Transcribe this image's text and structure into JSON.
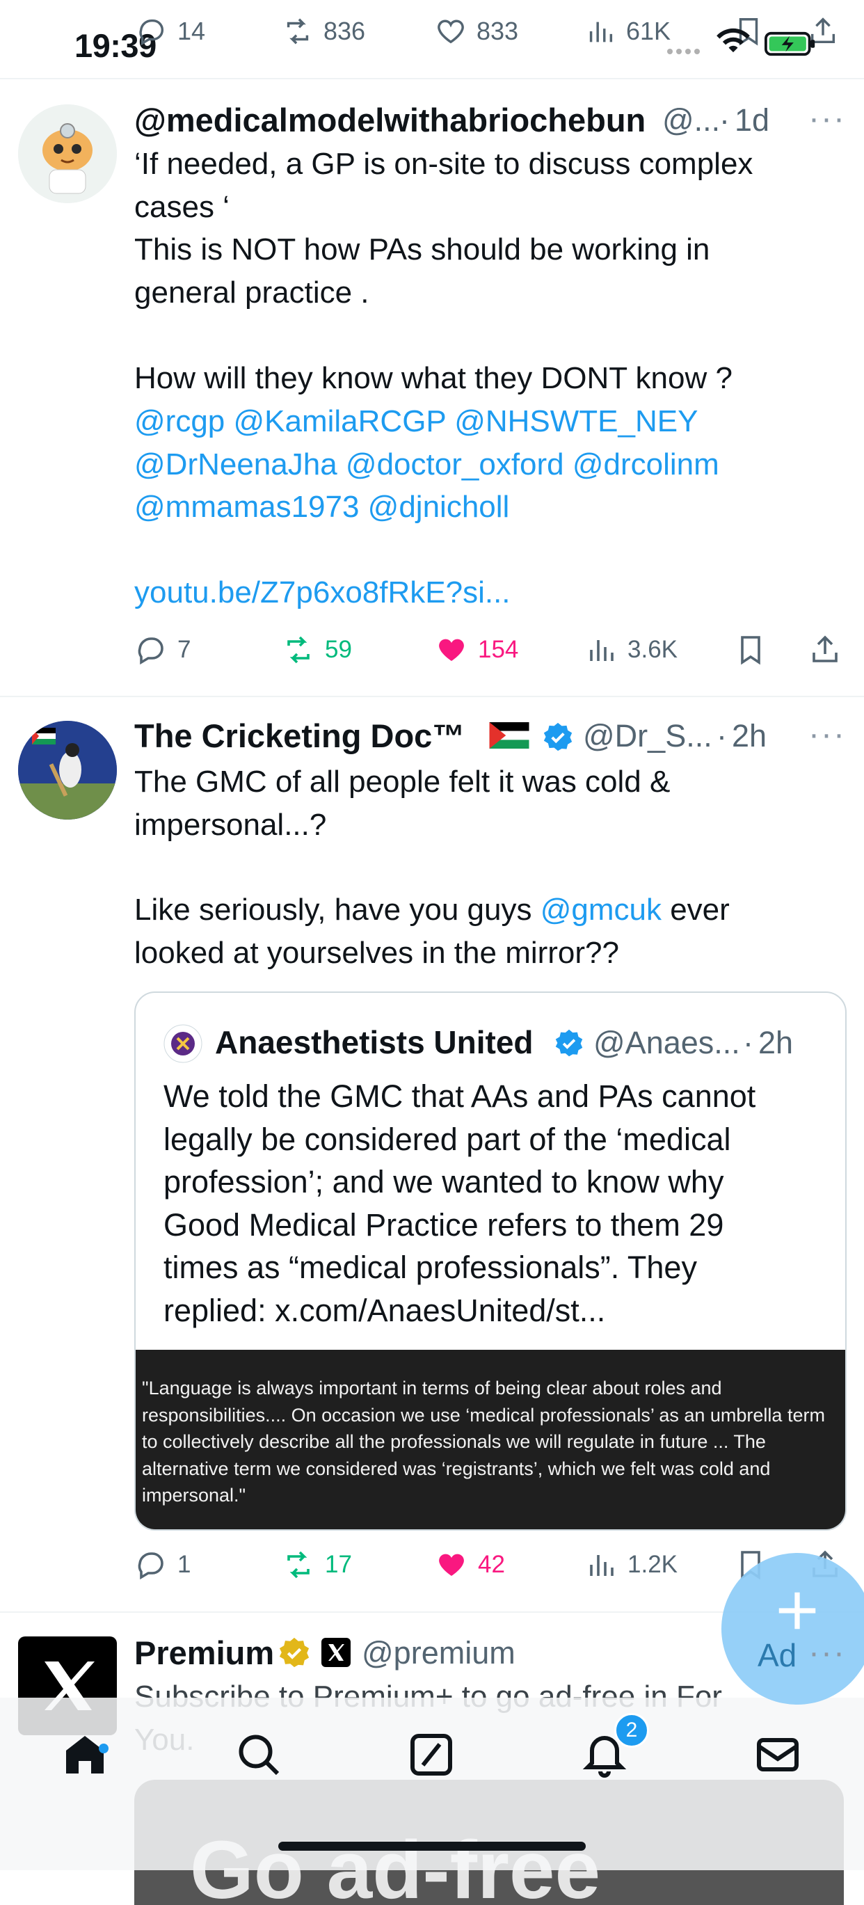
{
  "status_bar": {
    "time": "19:39"
  },
  "prev_tweet_actions": {
    "replies": "14",
    "reposts": "836",
    "likes": "833",
    "views": "61K"
  },
  "tweet1": {
    "name": "@medicalmodelwithabriochebun",
    "handle": "@...",
    "dot": "·",
    "time": "1d",
    "more": "···",
    "line1": "‘If needed, a GP is on-site  to discuss complex\ncases ‘\nThis is NOT how PAs should be working in\ngeneral practice .",
    "line2": "How will they know what they DONT know ?",
    "mentions": "@rcgp @KamilaRCGP @NHSWTE_NEY\n@DrNeenaJha @doctor_oxford @drcolinm\n@mmamas1973 @djnicholl",
    "link": "youtu.be/Z7p6xo8fRkE?si...",
    "replies": "7",
    "reposts": "59",
    "likes": "154",
    "views": "3.6K"
  },
  "tweet2": {
    "name": "The Cricketing Doc™",
    "handle": "@Dr_S...",
    "dot": "·",
    "time": "2h",
    "more": "···",
    "line1": "The GMC of all people felt it was cold &\nimpersonal...?",
    "line2a": "Like seriously, have you guys ",
    "mention": "@gmcuk",
    "line2b": " ever",
    "line2c": "looked at yourselves in the mirror??",
    "replies": "1",
    "reposts": "17",
    "likes": "42",
    "views": "1.2K"
  },
  "quote": {
    "name": "Anaesthetists United",
    "handle": "@Anaes...",
    "dot": "·",
    "time": "2h",
    "text": "We told the GMC that AAs and PAs cannot\nlegally be considered part of the ‘medical\nprofession’; and we wanted to know why\nGood Medical Practice refers to them 29\ntimes as “medical professionals”. They\nreplied: x.com/AnaesUnited/st...",
    "image_text": " \"Language is always important in terms of being clear about roles and\nresponsibilities.... On occasion we use ‘medical professionals’ as an umbrella term\nto collectively describe all the professionals we will regulate in future ...  The\nalternative term we considered was ‘registrants’, which we felt was cold and\nimpersonal.\""
  },
  "tweet3": {
    "name": "Premium",
    "handle": "@premium",
    "text": "Subscribe to Premium+ to go ad-free in For\nYou.",
    "ad_label": "Ad",
    "promo_text": "Go ad-free"
  },
  "fab": {
    "icon": "plus-icon"
  },
  "nav": {
    "notification_count": "2"
  },
  "colors": {
    "accent": "#1d9bf0",
    "like": "#f91880",
    "repost": "#00ba7c"
  }
}
